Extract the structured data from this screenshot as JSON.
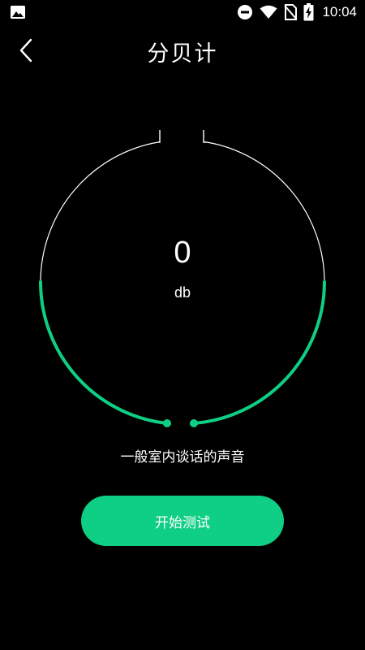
{
  "status_bar": {
    "time": "10:04",
    "icons": [
      "image-icon",
      "dnd-icon",
      "wifi-icon",
      "no-sim-icon",
      "battery-charging-icon"
    ]
  },
  "header": {
    "back_icon": "chevron-left-icon",
    "title": "分贝计"
  },
  "meter": {
    "value": "0",
    "unit": "db",
    "description": "一般室内谈话的声音",
    "track_color": "#ffffff",
    "active_color": "#0ecf84"
  },
  "actions": {
    "start_label": "开始测试"
  }
}
